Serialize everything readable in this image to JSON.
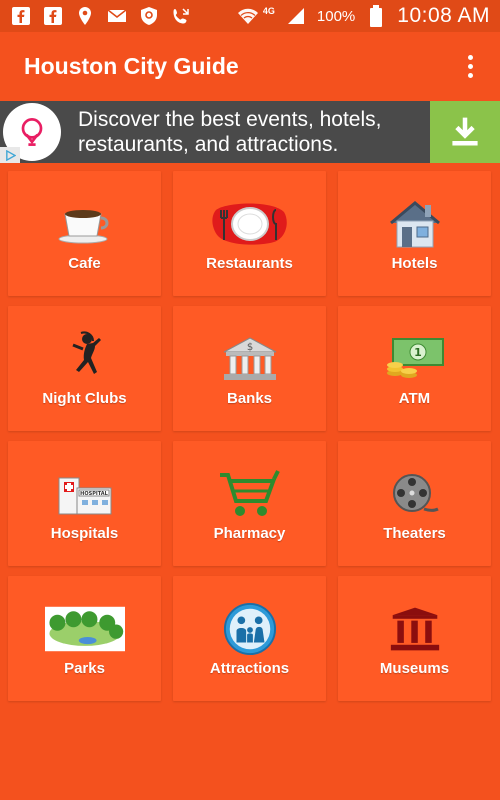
{
  "status_bar": {
    "icons_left": [
      "facebook-icon",
      "facebook-icon",
      "location-pin-icon",
      "mail-icon",
      "shield-icon",
      "phone-arrow-icon"
    ],
    "network": "4G",
    "battery": "100%",
    "time": "10:08 AM"
  },
  "app_bar": {
    "title": "Houston City Guide",
    "menu_icon": "overflow-menu-icon"
  },
  "ad": {
    "text_line1": "Discover the best events, hotels,",
    "text_line2": "restaurants, and attractions.",
    "accent_color": "#e91e63",
    "download_color": "#8bc34a"
  },
  "categories": [
    {
      "label": "Cafe",
      "icon": "coffee-cup-icon"
    },
    {
      "label": "Restaurants",
      "icon": "plate-utensils-icon"
    },
    {
      "label": "Hotels",
      "icon": "house-icon"
    },
    {
      "label": "Night Clubs",
      "icon": "dancer-icon"
    },
    {
      "label": "Banks",
      "icon": "bank-icon"
    },
    {
      "label": "ATM",
      "icon": "money-icon"
    },
    {
      "label": "Hospitals",
      "icon": "hospital-icon"
    },
    {
      "label": "Pharmacy",
      "icon": "shopping-cart-icon"
    },
    {
      "label": "Theaters",
      "icon": "film-reel-icon"
    },
    {
      "label": "Parks",
      "icon": "park-icon"
    },
    {
      "label": "Attractions",
      "icon": "family-icon"
    },
    {
      "label": "Museums",
      "icon": "museum-icon"
    }
  ],
  "colors": {
    "primary": "#f4511e",
    "tile": "#ff5a25",
    "status_bar": "#e04a17"
  }
}
